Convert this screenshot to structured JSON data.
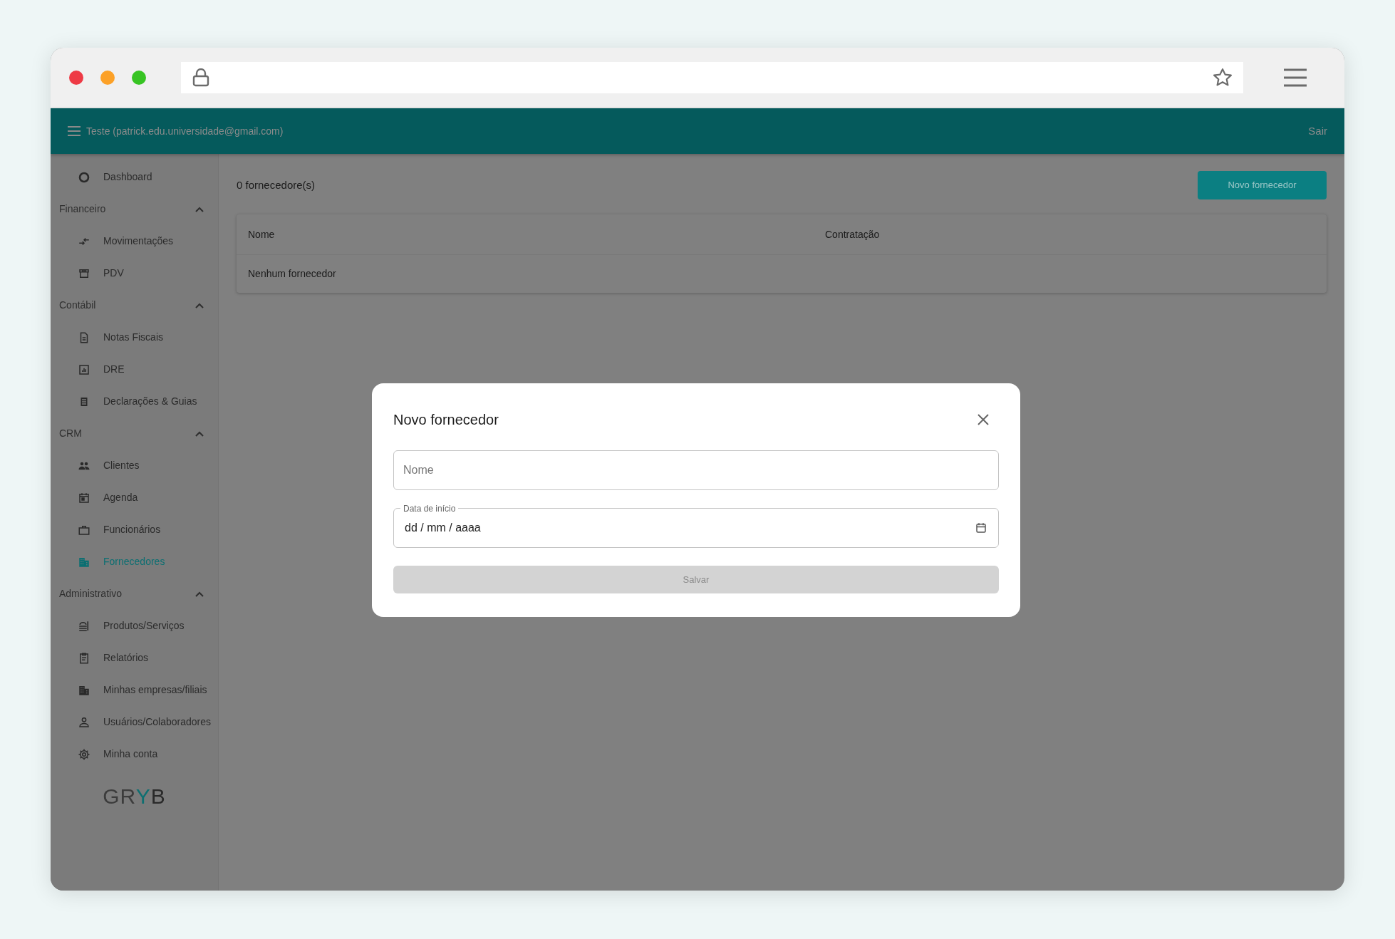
{
  "header": {
    "user_label": "Teste (patrick.edu.universidade@gmail.com)",
    "logout": "Sair"
  },
  "sidebar": {
    "sections": [
      {
        "kind": "link",
        "label": "Dashboard",
        "selected": false
      },
      {
        "kind": "group",
        "label": "Financeiro",
        "expanded": true,
        "items": [
          {
            "label": "Movimentações",
            "selected": false
          },
          {
            "label": "PDV",
            "selected": false
          }
        ]
      },
      {
        "kind": "group",
        "label": "Contábil",
        "expanded": true,
        "items": [
          {
            "label": "Notas Fiscais",
            "selected": false
          },
          {
            "label": "DRE",
            "selected": false
          },
          {
            "label": "Declarações & Guias",
            "selected": false
          }
        ]
      },
      {
        "kind": "group",
        "label": "CRM",
        "expanded": true,
        "items": [
          {
            "label": "Clientes",
            "selected": false
          },
          {
            "label": "Agenda",
            "selected": false
          },
          {
            "label": "Funcionários",
            "selected": false
          },
          {
            "label": "Fornecedores",
            "selected": true
          }
        ]
      },
      {
        "kind": "group",
        "label": "Administrativo",
        "expanded": true,
        "items": [
          {
            "label": "Produtos/Serviços",
            "selected": false
          },
          {
            "label": "Relatórios",
            "selected": false
          },
          {
            "label": "Minhas empresas/filiais",
            "selected": false
          },
          {
            "label": "Usuários/Colaboradores",
            "selected": false
          },
          {
            "label": "Minha conta",
            "selected": false
          }
        ]
      }
    ],
    "logo": [
      {
        "text": "GR",
        "color": "#3c3c3c"
      },
      {
        "text": "Y",
        "color": "#0e6f71"
      },
      {
        "text": "B",
        "color": "#2a2a2a"
      }
    ]
  },
  "content": {
    "count": "0 fornecedore(s)",
    "new_button": "Novo fornecedor",
    "table": {
      "columns": [
        "Nome",
        "Contratação"
      ],
      "empty_message": "Nenhum fornecedor"
    }
  },
  "dialog": {
    "title": "Novo fornecedor",
    "fields": [
      {
        "kind": "text",
        "placeholder": "Nome"
      },
      {
        "kind": "date",
        "label": "Data de início",
        "value": "dd / mm / aaaa"
      }
    ],
    "save_button": {
      "label": "Salvar",
      "disabled": true
    }
  }
}
